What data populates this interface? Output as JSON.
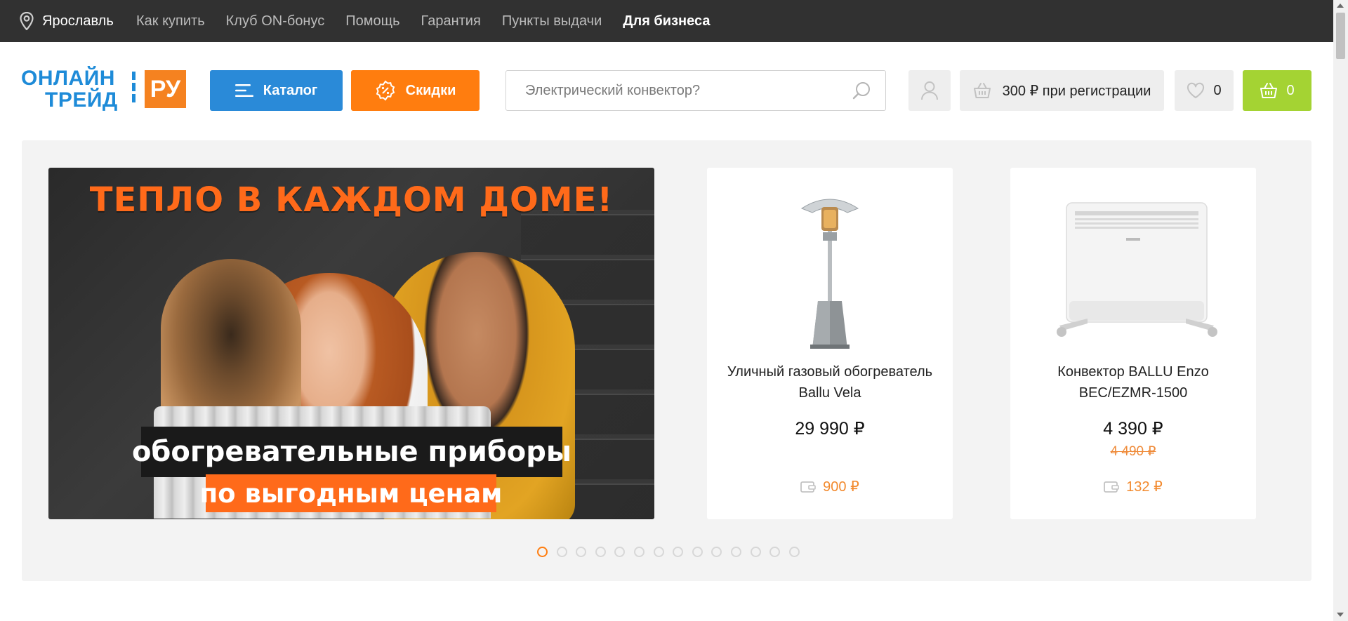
{
  "topbar": {
    "city": "Ярославль",
    "links": [
      "Как купить",
      "Клуб ON-бонус",
      "Помощь",
      "Гарантия",
      "Пункты выдачи"
    ],
    "business_link": "Для бизнеса"
  },
  "logo": {
    "line1": "ОНЛАЙН",
    "line2": "ТРЕЙД",
    "badge": "РУ"
  },
  "header": {
    "catalog_label": "Каталог",
    "sales_label": "Скидки",
    "search_placeholder": "Электрический конвектор?",
    "bonus_text": "300 ₽ при регистрации",
    "favorites_count": "0",
    "cart_count": "0"
  },
  "colors": {
    "topbar_bg": "#313131",
    "catalog_blue": "#2a8ad8",
    "sales_orange": "#ff7d0f",
    "cart_green": "#a4d333",
    "bonus_orange": "#f28a2e"
  },
  "banner": {
    "headline": "ТЕПЛО В КАЖДОМ ДОМЕ!",
    "caption_line1": "обогревательные приборы",
    "caption_line2": "по выгодным ценам"
  },
  "products": [
    {
      "name": "Уличный газовый обогреватель Ballu Vela",
      "price": "29 990 ₽",
      "old_price": "",
      "bonus": "900 ₽",
      "image_icon": "patio-heater-image"
    },
    {
      "name": "Конвектор BALLU Enzo BEC/EZMR-1500",
      "price": "4 390 ₽",
      "old_price": "4 490 ₽",
      "bonus": "132 ₽",
      "image_icon": "convector-heater-image"
    }
  ],
  "slider": {
    "slide_count": 14,
    "active_index": 0
  }
}
